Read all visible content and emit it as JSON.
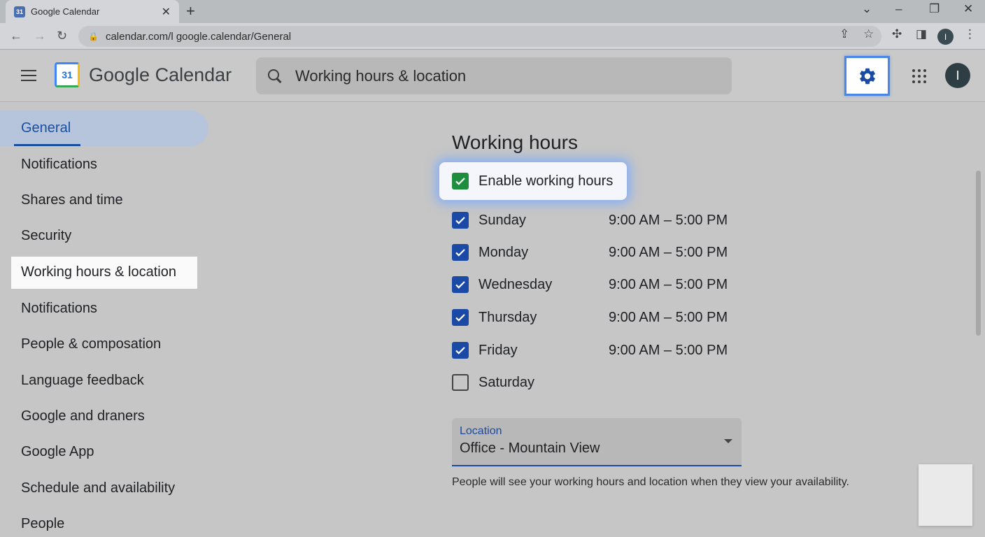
{
  "browser": {
    "tab_title": "Google Calendar",
    "tab_favicon_text": "31",
    "url": "calendar.com/l google.calendar/General",
    "profile_initial": "I"
  },
  "app": {
    "title": "Google Calendar",
    "logo_text": "31",
    "search_value": "Working hours & location",
    "avatar_initial": "I"
  },
  "sidebar": {
    "items": [
      {
        "label": "General"
      },
      {
        "label": "Notifications"
      },
      {
        "label": "Shares and time"
      },
      {
        "label": "Security"
      },
      {
        "label": "Working hours & location"
      },
      {
        "label": "Notifications"
      },
      {
        "label": "People & composation"
      },
      {
        "label": "Language feedback"
      },
      {
        "label": "Google and draners"
      },
      {
        "label": "Google App"
      },
      {
        "label": "Schedule and availability"
      },
      {
        "label": "People"
      }
    ]
  },
  "working_hours": {
    "title": "Working hours",
    "enable_label": "Enable working hours",
    "enabled": true,
    "days": [
      {
        "label": "Sunday",
        "checked": true,
        "hours": "9:00 AM – 5:00 PM"
      },
      {
        "label": "Monday",
        "checked": true,
        "hours": "9:00 AM – 5:00 PM"
      },
      {
        "label": "Wednesday",
        "checked": true,
        "hours": "9:00 AM – 5:00 PM"
      },
      {
        "label": "Thursday",
        "checked": true,
        "hours": "9:00 AM – 5:00 PM"
      },
      {
        "label": "Friday",
        "checked": true,
        "hours": "9:00 AM – 5:00 PM"
      },
      {
        "label": "Saturday",
        "checked": false,
        "hours": ""
      }
    ]
  },
  "location": {
    "label": "Location",
    "value": "Office - Mountain View",
    "helper": "People will see your working hours and location when they view your availability."
  },
  "colors": {
    "accent": "#1b4aa6",
    "enable_check": "#1e8e3e",
    "gear_highlight": "#4a86e8"
  }
}
